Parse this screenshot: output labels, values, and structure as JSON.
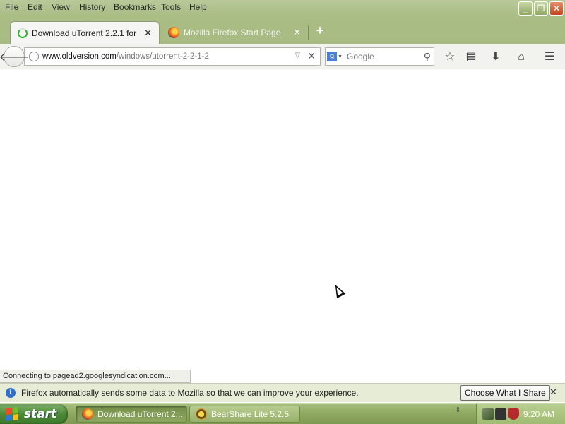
{
  "menubar": {
    "items": [
      {
        "label": "File",
        "u": "F",
        "rest": "ile"
      },
      {
        "label": "Edit",
        "u": "E",
        "rest": "dit"
      },
      {
        "label": "View",
        "u": "V",
        "rest": "iew"
      },
      {
        "label": "History",
        "pre": "Hi",
        "u": "s",
        "rest": "tory"
      },
      {
        "label": "Bookmarks",
        "u": "B",
        "rest": "ookmarks"
      },
      {
        "label": "Tools",
        "u": "T",
        "rest": "ools"
      },
      {
        "label": "Help",
        "u": "H",
        "rest": "elp"
      }
    ]
  },
  "window_controls": {
    "minimize": "_",
    "restore": "❐",
    "close": "✕"
  },
  "tabs": [
    {
      "title": "Download uTorrent 2.2.1 for ...",
      "active": true,
      "close": "✕"
    },
    {
      "title": "Mozilla Firefox Start Page",
      "active": false,
      "close": "✕"
    }
  ],
  "new_tab_label": "+",
  "navbar": {
    "back": "🡐",
    "url_host": "www.oldversion.com",
    "url_path": "/windows/utorrent-2-2-1-2",
    "url_dropdown": "▽",
    "url_stop": "✕",
    "search_engine_letter": "g",
    "search_placeholder": "Google",
    "search_go": "⚲",
    "icons": {
      "bookmark_star": "☆",
      "bookmarks_menu": "▤",
      "downloads": "⬇",
      "home": "⌂",
      "menu": "☰"
    }
  },
  "status_text": "Connecting to pagead2.googlesyndication.com...",
  "notification": {
    "icon": "i",
    "text": "Firefox automatically sends some data to Mozilla so that we can improve your experience.",
    "button": "Choose What I Share",
    "close": "✕"
  },
  "taskbar": {
    "start_label": "start",
    "buttons": [
      {
        "label": "Download uTorrent 2...",
        "active": true,
        "icon": "firefox-icon"
      },
      {
        "label": "BearShare Lite 5.2.5",
        "active": false,
        "icon": "bearshare-icon"
      }
    ],
    "tray_toggle": "⇳",
    "clock": "9:20 AM"
  }
}
